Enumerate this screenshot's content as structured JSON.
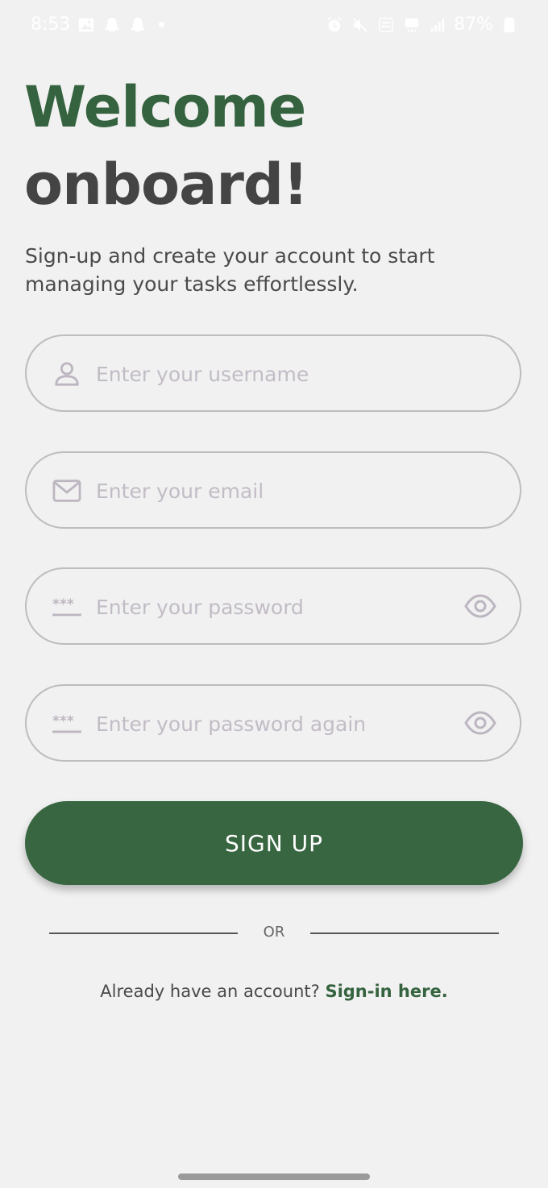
{
  "status_bar": {
    "time": "8:53",
    "battery": "87%",
    "icons_left": [
      "gallery-icon",
      "snapchat-icon",
      "snapchat-icon",
      "notification-dot"
    ],
    "icons_right": [
      "alarm-icon",
      "mute-icon",
      "volte-icon",
      "5g-icon",
      "signal-icon",
      "battery-icon"
    ]
  },
  "header": {
    "title_line1": "Welcome",
    "title_line2": "onboard!",
    "subtitle": "Sign-up and create your account to start managing your tasks effortlessly."
  },
  "form": {
    "username_placeholder": "Enter your username",
    "email_placeholder": "Enter your email",
    "password_placeholder": "Enter your password",
    "password_again_placeholder": "Enter your password again",
    "submit_label": "SIGN UP"
  },
  "divider": {
    "label": "OR"
  },
  "footer": {
    "prompt": "Already have an account?",
    "link": "Sign-in here."
  },
  "colors": {
    "accent": "#35633f",
    "button": "#376641",
    "background": "#f1f1f1",
    "placeholder": "#c2bcc6"
  }
}
